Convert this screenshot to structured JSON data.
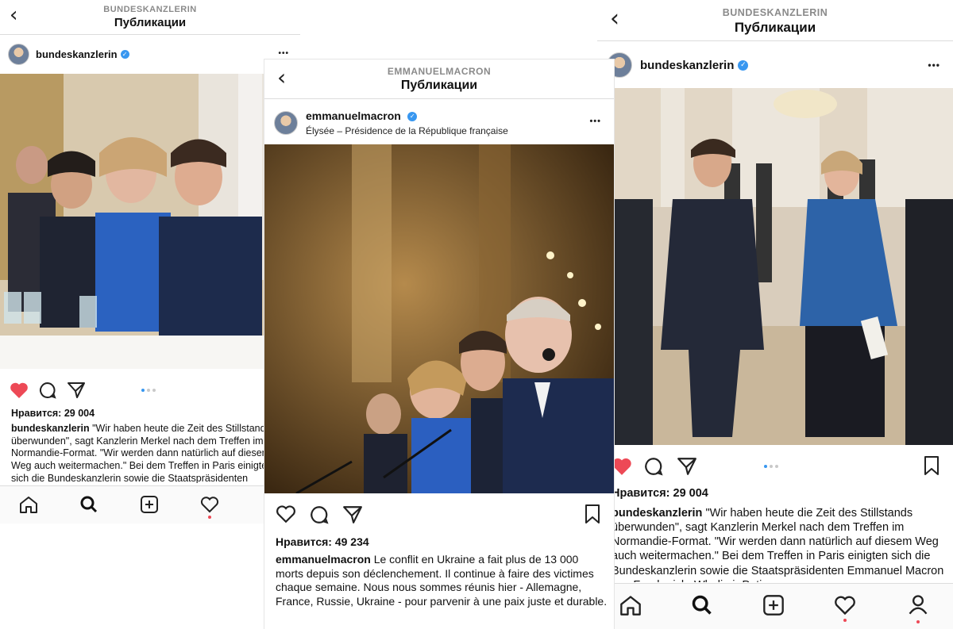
{
  "screens": {
    "left": {
      "subtitle": "BUNDESKANZLERIN",
      "title": "Публикации",
      "username": "bundeskanzlerin",
      "likes": "Нравится: 29 004",
      "caption_user": "bundeskanzlerin",
      "caption_text": "\"Wir haben heute die Zeit des Stillstands überwunden\", sagt Kanzlerin Merkel nach dem Treffen im Normandie-Format. \"Wir werden dann natürlich auf diesem Weg auch weitermachen.\" Bei dem Treffen in Paris einigten sich die Bundeskanzlerin sowie die Staatspräsidenten Emmanuel Macron aus Frankreich, Wladimir Putin aus"
    },
    "middle": {
      "subtitle": "EMMANUELMACRON",
      "title": "Публикации",
      "username": "emmanuelmacron",
      "location": "Élysée – Présidence de la République française",
      "likes": "Нравится: 49 234",
      "caption_user": "emmanuelmacron",
      "caption_text": "Le conflit en Ukraine a fait plus de 13 000 morts depuis son déclenchement. Il continue à faire des victimes chaque semaine. Nous nous sommes réunis hier - Allemagne, France, Russie, Ukraine - pour parvenir à une paix juste et durable."
    },
    "right": {
      "subtitle": "BUNDESKANZLERIN",
      "title": "Публикации",
      "username": "bundeskanzlerin",
      "likes": "Нравится: 29 004",
      "caption_user": "bundeskanzlerin",
      "caption_text": "\"Wir haben heute die Zeit des Stillstands überwunden\", sagt Kanzlerin Merkel nach dem Treffen im Normandie-Format. \"Wir werden dann natürlich auf diesem Weg auch weitermachen.\" Bei dem Treffen in Paris einigten sich die Bundeskanzlerin sowie die Staatspräsidenten Emmanuel Macron aus Frankreich, Wladimir Putin aus"
    }
  },
  "icons": {
    "back": "‹",
    "more": "•••",
    "verified": "✓"
  },
  "colors": {
    "like_red": "#ed4956",
    "verified_blue": "#3897f0"
  }
}
